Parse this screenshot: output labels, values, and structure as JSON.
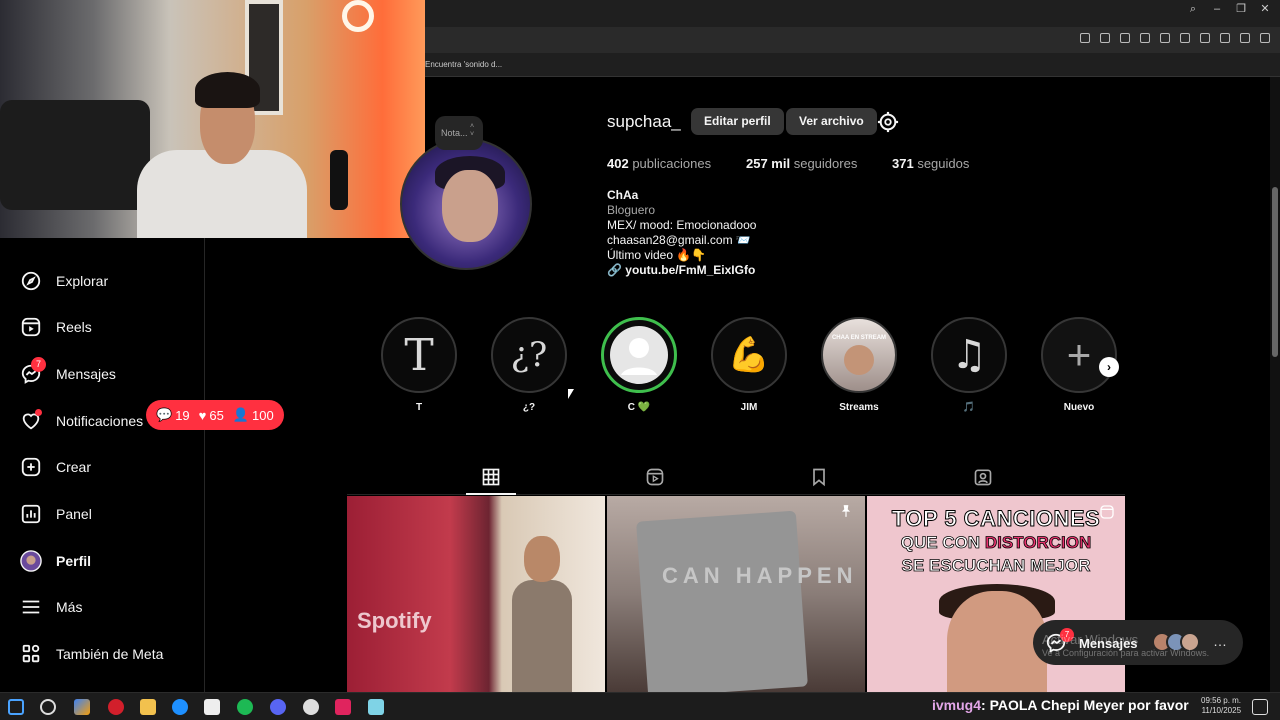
{
  "browser": {
    "bookmark_label": "Encuentra 'sonido d..."
  },
  "sidebar": {
    "items": [
      {
        "label": "Explorar",
        "icon": "compass-icon"
      },
      {
        "label": "Reels",
        "icon": "reels-icon"
      },
      {
        "label": "Mensajes",
        "icon": "messenger-icon"
      },
      {
        "label": "Notificaciones",
        "icon": "heart-icon"
      },
      {
        "label": "Crear",
        "icon": "plus-square-icon"
      },
      {
        "label": "Panel",
        "icon": "chart-icon"
      },
      {
        "label": "Perfil",
        "icon": "avatar"
      },
      {
        "label": "Más",
        "icon": "menu-icon"
      },
      {
        "label": "También de Meta",
        "icon": "meta-grid-icon"
      }
    ],
    "messages_badge": "7",
    "notifications": {
      "comments": "19",
      "likes": "65",
      "follows": "100"
    }
  },
  "profile": {
    "note_placeholder": "Nota...",
    "username": "supchaa_",
    "edit_button": "Editar perfil",
    "archive_button": "Ver archivo",
    "stats": [
      {
        "value": "402",
        "label": "publicaciones"
      },
      {
        "value": "257 mil",
        "label": "seguidores"
      },
      {
        "value": "371",
        "label": "seguidos"
      }
    ],
    "bio": {
      "name": "ChAa",
      "category": "Bloguero",
      "line1": "MEX/ mood: Emocionadooo",
      "line2": "chaasan28@gmail.com 📨",
      "line3": "Último video 🔥👇",
      "link": "youtu.be/FmM_EixIGfo"
    }
  },
  "highlights": [
    {
      "label": "T",
      "glyph": "T"
    },
    {
      "label": "¿?",
      "glyph": "¿?"
    },
    {
      "label": "C 💚",
      "glyph": ""
    },
    {
      "label": "JIM",
      "glyph": "💪"
    },
    {
      "label": "Streams",
      "glyph": "CHAA EN STREAM"
    },
    {
      "label": "🎵",
      "glyph": "♫"
    },
    {
      "label": "Nuevo",
      "glyph": "+"
    }
  ],
  "posts": [
    {
      "overlay": "Spotify"
    },
    {
      "overlay": "CAN HAPPEN"
    },
    {
      "overlay_line1": "TOP 5 CANCIONES",
      "overlay_line2a": "QUE CON ",
      "overlay_line2b": "DISTORCION",
      "overlay_line3": "SE ESCUCHAN MEJOR"
    }
  ],
  "messages_popup": {
    "label": "Mensajes",
    "badge": "7"
  },
  "windows_watermark": {
    "title": "Activar Windows",
    "subtitle": "Ve a Configuración para activar Windows."
  },
  "stream_chat": {
    "user": "ivmug4",
    "message": ": PAOLA Chepi Meyer por favor"
  },
  "clock": {
    "time": "09:56 p. m.",
    "date": "11/10/2025"
  },
  "colors": {
    "accent_red": "#ff3040",
    "green_ring": "#3fbf4d",
    "purple": "#8f6ff0"
  }
}
